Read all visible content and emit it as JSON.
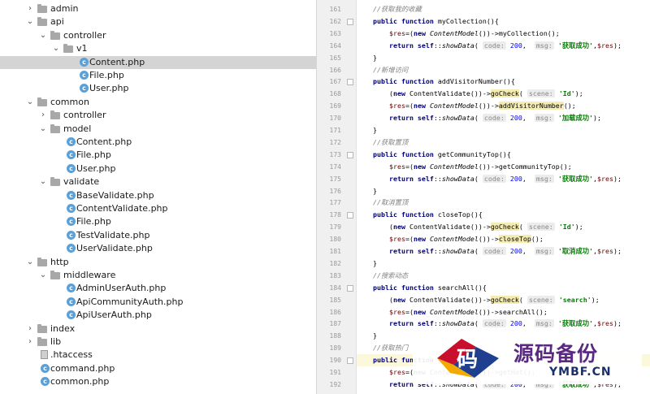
{
  "tree": [
    {
      "name": "admin",
      "type": "folder",
      "depth": 0,
      "expanded": false
    },
    {
      "name": "api",
      "type": "folder",
      "depth": 0,
      "expanded": true
    },
    {
      "name": "controller",
      "type": "folder",
      "depth": 1,
      "expanded": true
    },
    {
      "name": "v1",
      "type": "folder",
      "depth": 2,
      "expanded": true
    },
    {
      "name": "Content.php",
      "type": "php",
      "depth": 3,
      "selected": true
    },
    {
      "name": "File.php",
      "type": "php",
      "depth": 3
    },
    {
      "name": "User.php",
      "type": "php",
      "depth": 3
    },
    {
      "name": "common",
      "type": "folder",
      "depth": 0,
      "expanded": true
    },
    {
      "name": "controller",
      "type": "folder",
      "depth": 1,
      "expanded": false
    },
    {
      "name": "model",
      "type": "folder",
      "depth": 1,
      "expanded": true
    },
    {
      "name": "Content.php",
      "type": "php",
      "depth": 2
    },
    {
      "name": "File.php",
      "type": "php",
      "depth": 2
    },
    {
      "name": "User.php",
      "type": "php",
      "depth": 2
    },
    {
      "name": "validate",
      "type": "folder",
      "depth": 1,
      "expanded": true
    },
    {
      "name": "BaseValidate.php",
      "type": "php",
      "depth": 2
    },
    {
      "name": "ContentValidate.php",
      "type": "php",
      "depth": 2
    },
    {
      "name": "File.php",
      "type": "php",
      "depth": 2
    },
    {
      "name": "TestValidate.php",
      "type": "php",
      "depth": 2
    },
    {
      "name": "UserValidate.php",
      "type": "php",
      "depth": 2
    },
    {
      "name": "http",
      "type": "folder",
      "depth": 0,
      "expanded": true
    },
    {
      "name": "middleware",
      "type": "folder",
      "depth": 1,
      "expanded": true
    },
    {
      "name": "AdminUserAuth.php",
      "type": "php",
      "depth": 2
    },
    {
      "name": "ApiCommunityAuth.php",
      "type": "php",
      "depth": 2
    },
    {
      "name": "ApiUserAuth.php",
      "type": "php",
      "depth": 2
    },
    {
      "name": "index",
      "type": "folder",
      "depth": 0,
      "expanded": false
    },
    {
      "name": "lib",
      "type": "folder",
      "depth": 0,
      "expanded": false
    },
    {
      "name": ".htaccess",
      "type": "file",
      "depth": 0
    },
    {
      "name": "command.php",
      "type": "php",
      "depth": 0
    },
    {
      "name": "common.php",
      "type": "php",
      "depth": 0
    }
  ],
  "editor": {
    "lines": [
      {
        "n": "161",
        "fold": false,
        "tokens": [
          [
            "    ",
            ""
          ],
          [
            "//获取我的收藏",
            "cm"
          ]
        ]
      },
      {
        "n": "162",
        "fold": true,
        "tokens": [
          [
            "    ",
            ""
          ],
          [
            "public function ",
            "kw"
          ],
          [
            "myCollection(){",
            ""
          ]
        ]
      },
      {
        "n": "163",
        "fold": false,
        "tokens": [
          [
            "        ",
            ""
          ],
          [
            "$res",
            "var"
          ],
          [
            "=(",
            ""
          ],
          [
            "new ",
            "kw"
          ],
          [
            "ContentModel",
            "cls"
          ],
          [
            "())->myCollection();",
            ""
          ]
        ]
      },
      {
        "n": "164",
        "fold": false,
        "tokens": [
          [
            "        ",
            ""
          ],
          [
            "return self",
            "kw"
          ],
          [
            "::",
            ""
          ],
          [
            "showData",
            "call"
          ],
          [
            "( ",
            ""
          ],
          [
            "code:",
            "hint"
          ],
          [
            " ",
            ""
          ],
          [
            "200",
            "num"
          ],
          [
            ",  ",
            ""
          ],
          [
            "msg:",
            "hint"
          ],
          [
            " ",
            ""
          ],
          [
            "'获取成功'",
            "str"
          ],
          [
            ",",
            ""
          ],
          [
            "$res",
            "var"
          ],
          [
            ");",
            ""
          ]
        ]
      },
      {
        "n": "165",
        "fold": false,
        "tokens": [
          [
            "    }",
            ""
          ]
        ]
      },
      {
        "n": "166",
        "fold": false,
        "tokens": [
          [
            "    ",
            ""
          ],
          [
            "//新增访问",
            "cm"
          ]
        ]
      },
      {
        "n": "167",
        "fold": true,
        "tokens": [
          [
            "    ",
            ""
          ],
          [
            "public function ",
            "kw"
          ],
          [
            "addVisitorNumber(){",
            ""
          ]
        ]
      },
      {
        "n": "168",
        "fold": false,
        "tokens": [
          [
            "        (",
            ""
          ],
          [
            "new ",
            "kw"
          ],
          [
            "ContentValidate())->",
            ""
          ],
          [
            "goCheck",
            "hlcall"
          ],
          [
            "( ",
            ""
          ],
          [
            "scene:",
            "hint"
          ],
          [
            " ",
            ""
          ],
          [
            "'Id'",
            "str"
          ],
          [
            ");",
            ""
          ]
        ]
      },
      {
        "n": "169",
        "fold": false,
        "tokens": [
          [
            "        ",
            ""
          ],
          [
            "$res",
            "var"
          ],
          [
            "=(",
            ""
          ],
          [
            "new ",
            "kw"
          ],
          [
            "ContentModel",
            "cls"
          ],
          [
            "())->",
            ""
          ],
          [
            "addVisitorNumber",
            "hlcall"
          ],
          [
            "();",
            ""
          ]
        ]
      },
      {
        "n": "170",
        "fold": false,
        "tokens": [
          [
            "        ",
            ""
          ],
          [
            "return self",
            "kw"
          ],
          [
            "::",
            ""
          ],
          [
            "showData",
            "call"
          ],
          [
            "( ",
            ""
          ],
          [
            "code:",
            "hint"
          ],
          [
            " ",
            ""
          ],
          [
            "200",
            "num"
          ],
          [
            ",  ",
            ""
          ],
          [
            "msg:",
            "hint"
          ],
          [
            " ",
            ""
          ],
          [
            "'加载成功'",
            "str"
          ],
          [
            ");",
            ""
          ]
        ]
      },
      {
        "n": "171",
        "fold": false,
        "tokens": [
          [
            "    }",
            ""
          ]
        ]
      },
      {
        "n": "172",
        "fold": false,
        "tokens": [
          [
            "    ",
            ""
          ],
          [
            "//获取置顶",
            "cm"
          ]
        ]
      },
      {
        "n": "173",
        "fold": true,
        "tokens": [
          [
            "    ",
            ""
          ],
          [
            "public function ",
            "kw"
          ],
          [
            "getCommunityTop(){",
            ""
          ]
        ]
      },
      {
        "n": "174",
        "fold": false,
        "tokens": [
          [
            "        ",
            ""
          ],
          [
            "$res",
            "var"
          ],
          [
            "=(",
            ""
          ],
          [
            "new ",
            "kw"
          ],
          [
            "ContentModel",
            "cls"
          ],
          [
            "())->getCommunityTop();",
            ""
          ]
        ]
      },
      {
        "n": "175",
        "fold": false,
        "tokens": [
          [
            "        ",
            ""
          ],
          [
            "return self",
            "kw"
          ],
          [
            "::",
            ""
          ],
          [
            "showData",
            "call"
          ],
          [
            "( ",
            ""
          ],
          [
            "code:",
            "hint"
          ],
          [
            " ",
            ""
          ],
          [
            "200",
            "num"
          ],
          [
            ",  ",
            ""
          ],
          [
            "msg:",
            "hint"
          ],
          [
            " ",
            ""
          ],
          [
            "'获取成功'",
            "str"
          ],
          [
            ",",
            ""
          ],
          [
            "$res",
            "var"
          ],
          [
            ");",
            ""
          ]
        ]
      },
      {
        "n": "176",
        "fold": false,
        "tokens": [
          [
            "    }",
            ""
          ]
        ]
      },
      {
        "n": "177",
        "fold": false,
        "tokens": [
          [
            "    ",
            ""
          ],
          [
            "//取消置顶",
            "cm"
          ]
        ]
      },
      {
        "n": "178",
        "fold": true,
        "tokens": [
          [
            "    ",
            ""
          ],
          [
            "public function ",
            "kw"
          ],
          [
            "closeTop(){",
            ""
          ]
        ]
      },
      {
        "n": "179",
        "fold": false,
        "tokens": [
          [
            "        (",
            ""
          ],
          [
            "new ",
            "kw"
          ],
          [
            "ContentValidate())->",
            ""
          ],
          [
            "goCheck",
            "hlcall"
          ],
          [
            "( ",
            ""
          ],
          [
            "scene:",
            "hint"
          ],
          [
            " ",
            ""
          ],
          [
            "'Id'",
            "str"
          ],
          [
            ");",
            ""
          ]
        ]
      },
      {
        "n": "180",
        "fold": false,
        "tokens": [
          [
            "        ",
            ""
          ],
          [
            "$res",
            "var"
          ],
          [
            "=(",
            ""
          ],
          [
            "new ",
            "kw"
          ],
          [
            "ContentModel",
            "cls"
          ],
          [
            "())->",
            ""
          ],
          [
            "closeTop",
            "hlcall"
          ],
          [
            "();",
            ""
          ]
        ]
      },
      {
        "n": "181",
        "fold": false,
        "tokens": [
          [
            "        ",
            ""
          ],
          [
            "return self",
            "kw"
          ],
          [
            "::",
            ""
          ],
          [
            "showData",
            "call"
          ],
          [
            "( ",
            ""
          ],
          [
            "code:",
            "hint"
          ],
          [
            " ",
            ""
          ],
          [
            "200",
            "num"
          ],
          [
            ",  ",
            ""
          ],
          [
            "msg:",
            "hint"
          ],
          [
            " ",
            ""
          ],
          [
            "'取消成功'",
            "str"
          ],
          [
            ",",
            ""
          ],
          [
            "$res",
            "var"
          ],
          [
            ");",
            ""
          ]
        ]
      },
      {
        "n": "182",
        "fold": false,
        "tokens": [
          [
            "    }",
            ""
          ]
        ]
      },
      {
        "n": "183",
        "fold": false,
        "tokens": [
          [
            "    ",
            ""
          ],
          [
            "//搜索动态",
            "cm"
          ]
        ]
      },
      {
        "n": "184",
        "fold": true,
        "tokens": [
          [
            "    ",
            ""
          ],
          [
            "public function ",
            "kw"
          ],
          [
            "searchAll(){",
            ""
          ]
        ]
      },
      {
        "n": "185",
        "fold": false,
        "tokens": [
          [
            "        (",
            ""
          ],
          [
            "new ",
            "kw"
          ],
          [
            "ContentValidate())->",
            ""
          ],
          [
            "goCheck",
            "hlcall"
          ],
          [
            "( ",
            ""
          ],
          [
            "scene:",
            "hint"
          ],
          [
            " ",
            ""
          ],
          [
            "'search'",
            "str"
          ],
          [
            ");",
            ""
          ]
        ]
      },
      {
        "n": "186",
        "fold": false,
        "tokens": [
          [
            "        ",
            ""
          ],
          [
            "$res",
            "var"
          ],
          [
            "=(",
            ""
          ],
          [
            "new ",
            "kw"
          ],
          [
            "ContentModel",
            "cls"
          ],
          [
            "())->searchAll();",
            ""
          ]
        ]
      },
      {
        "n": "187",
        "fold": false,
        "tokens": [
          [
            "        ",
            ""
          ],
          [
            "return self",
            "kw"
          ],
          [
            "::",
            ""
          ],
          [
            "showData",
            "call"
          ],
          [
            "( ",
            ""
          ],
          [
            "code:",
            "hint"
          ],
          [
            " ",
            ""
          ],
          [
            "200",
            "num"
          ],
          [
            ",  ",
            ""
          ],
          [
            "msg:",
            "hint"
          ],
          [
            " ",
            ""
          ],
          [
            "'获取成功'",
            "str"
          ],
          [
            ",",
            ""
          ],
          [
            "$res",
            "var"
          ],
          [
            ");",
            ""
          ]
        ]
      },
      {
        "n": "188",
        "fold": false,
        "tokens": [
          [
            "    }",
            ""
          ]
        ]
      },
      {
        "n": "189",
        "fold": false,
        "tokens": [
          [
            "    ",
            ""
          ],
          [
            "//获取热门",
            "cm"
          ]
        ]
      },
      {
        "n": "190",
        "fold": true,
        "highlight": true,
        "tokens": [
          [
            "    ",
            ""
          ],
          [
            "public function ",
            "kw"
          ],
          [
            "getHot(){",
            ""
          ]
        ]
      },
      {
        "n": "191",
        "fold": false,
        "tokens": [
          [
            "        ",
            ""
          ],
          [
            "$res",
            "var"
          ],
          [
            "=(",
            ""
          ],
          [
            "new ",
            "kw"
          ],
          [
            "ContentModel",
            "cls"
          ],
          [
            "())->getHot();",
            ""
          ]
        ]
      },
      {
        "n": "192",
        "fold": false,
        "tokens": [
          [
            "        ",
            ""
          ],
          [
            "return self",
            "kw"
          ],
          [
            "::",
            ""
          ],
          [
            "showData",
            "call"
          ],
          [
            "( ",
            ""
          ],
          [
            "code:",
            "hint"
          ],
          [
            " ",
            ""
          ],
          [
            "200",
            "num"
          ],
          [
            ",  ",
            ""
          ],
          [
            "msg:",
            "hint"
          ],
          [
            " ",
            ""
          ],
          [
            "'获取成功'",
            "str"
          ],
          [
            ",",
            ""
          ],
          [
            "$res",
            "var"
          ],
          [
            ");",
            ""
          ]
        ]
      }
    ]
  },
  "watermark": {
    "glyph": "码",
    "cn": "源码备份",
    "en": "YMBF.CN"
  },
  "colors": {
    "selected_row": "#d4d4d4",
    "current_line": "#fcf8dc",
    "keyword": "#000080",
    "string": "#008000",
    "number": "#0000ff",
    "comment": "#808080"
  }
}
